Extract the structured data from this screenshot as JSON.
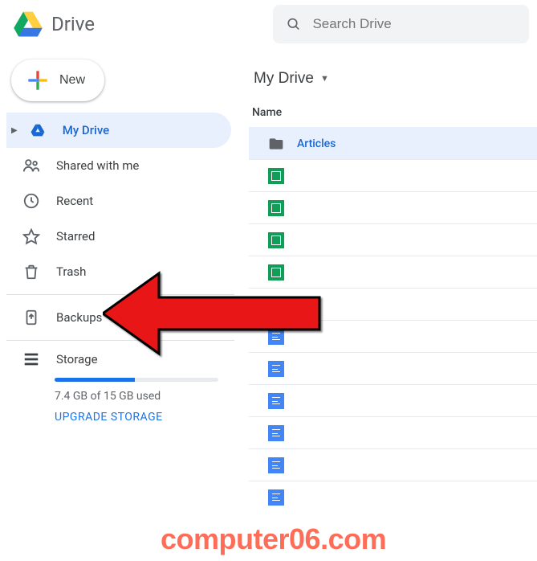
{
  "app": {
    "title": "Drive"
  },
  "search": {
    "placeholder": "Search Drive"
  },
  "new_button": {
    "label": "New"
  },
  "sidebar": {
    "items": [
      {
        "label": "My Drive"
      },
      {
        "label": "Shared with me"
      },
      {
        "label": "Recent"
      },
      {
        "label": "Starred"
      },
      {
        "label": "Trash"
      },
      {
        "label": "Backups"
      }
    ],
    "storage": {
      "label": "Storage",
      "used_text": "7.4 GB of 15 GB used",
      "upgrade": "UPGRADE STORAGE",
      "fill_percent": 49
    }
  },
  "breadcrumb": {
    "label": "My Drive"
  },
  "columns": {
    "name": "Name"
  },
  "files": [
    {
      "name": "Articles",
      "type": "folder",
      "selected": true
    },
    {
      "name": "",
      "type": "sheets"
    },
    {
      "name": "",
      "type": "sheets"
    },
    {
      "name": "",
      "type": "sheets"
    },
    {
      "name": "",
      "type": "sheets"
    },
    {
      "name": "",
      "type": "drawing"
    },
    {
      "name": "",
      "type": "docs"
    },
    {
      "name": "",
      "type": "docs"
    },
    {
      "name": "",
      "type": "docs"
    },
    {
      "name": "",
      "type": "docs"
    },
    {
      "name": "",
      "type": "docs"
    },
    {
      "name": "",
      "type": "docs"
    }
  ],
  "watermark": "computer06.com"
}
